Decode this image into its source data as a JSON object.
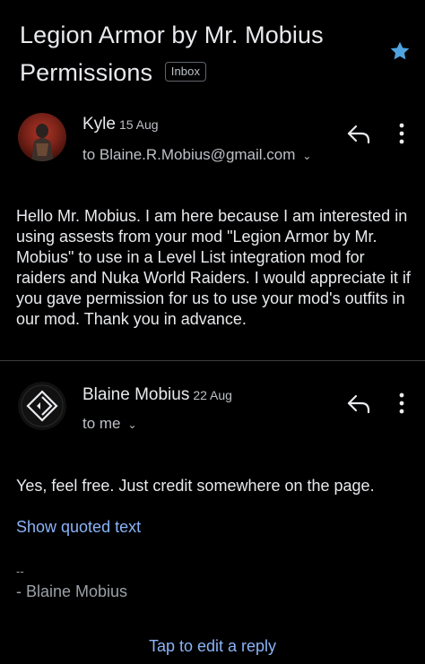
{
  "subject": {
    "title": "Legion Armor by Mr. Mobius Permissions",
    "label": "Inbox"
  },
  "colors": {
    "accent": "#8ab4f8",
    "star": "#4fa3e0",
    "background": "#000000"
  },
  "messages": [
    {
      "sender": "Kyle",
      "date": "15 Aug",
      "recipient": "to Blaine.R.Mobius@gmail.com",
      "body": "Hello  Mr. Mobius. I am here because I am interested in using assests from your mod \"Legion Armor by Mr. Mobius\" to use in a Level List integration mod for raiders and Nuka World Raiders. I would appreciate it if you gave permission for us to use your mod's outfits in our mod. Thank you in advance."
    },
    {
      "sender": "Blaine Mobius",
      "date": "22 Aug",
      "recipient": "to me",
      "body": "Yes, feel free. Just credit somewhere on the page."
    }
  ],
  "quoted_link": "Show quoted text",
  "signature": {
    "dashes": "--",
    "name": "- Blaine Mobius"
  },
  "footer": {
    "reply_prompt": "Tap to edit a reply"
  }
}
